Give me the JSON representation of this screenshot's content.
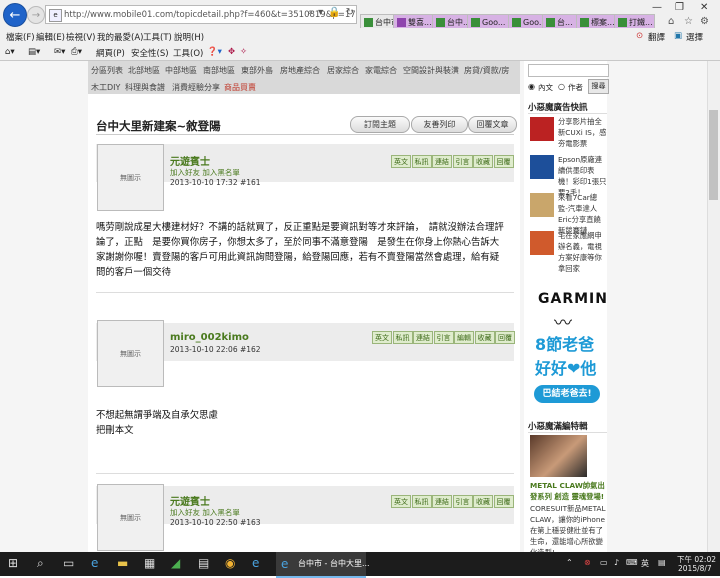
{
  "browser": {
    "url": "http://www.mobile01.com/topicdetail.php?f=460&t=3510819&p=17",
    "favicon_text": "e",
    "tabs": [
      {
        "label": "台中市",
        "color": "#e8e8e8"
      },
      {
        "label": "雙喜...",
        "color": "#d7b2e4"
      },
      {
        "label": "台中...",
        "color": "#d7b2e4"
      },
      {
        "label": "Goo...",
        "color": "#d7b2e4"
      },
      {
        "label": "Goo...",
        "color": "#d7b2e4"
      },
      {
        "label": "台...",
        "color": "#d7b2e4"
      },
      {
        "label": "標案...",
        "color": "#d7b2e4"
      },
      {
        "label": "打鐵...",
        "color": "#d7b2e4"
      }
    ],
    "menu": [
      "檔案(F)",
      "編輯(E)",
      "檢視(V)",
      "我的最愛(A)",
      "工具(T)",
      "說明(H)"
    ],
    "toolbar": [
      "網頁(P)",
      "安全性(S)",
      "工具(O)"
    ],
    "toolbar_right": [
      "翻譯",
      "選擇"
    ]
  },
  "subnav": {
    "row1": [
      "分區列表",
      "北部地區",
      "中部地區",
      "南部地區",
      "東部外島",
      "房地產綜合",
      "居家綜合",
      "家電綜合",
      "空間設計與裝潢",
      "房貸/資款/房"
    ],
    "row2": [
      "木工DIY",
      "科理與食譜",
      "消費經驗分享",
      "商品買賣"
    ]
  },
  "topic": {
    "title": "台中大里新建案~敘登陽",
    "buttons": [
      "訂閱主題",
      "友善列印",
      "回覆文章"
    ]
  },
  "posts": [
    {
      "avatar": "無圖示",
      "user": "元遊賓士",
      "links": "加入好友  加入黑名單",
      "meta": "2013-10-10 17:32  #161",
      "actions": [
        "英文",
        "私訊",
        "連結",
        "引言",
        "收藏",
        "回覆"
      ],
      "text": "嗎劳剛說成星大樓建材好？不講的話就買了，反正重點是要資訊對等才來評論，　請就沒辦法合理評論了，正點　是要你買你房子，你想太多了，至於同事不滿意登陽　是發生在你身上你熱心告訴大家謝謝你喔！賣登陽的客戶可用此資訊詢問登陽，給登陽回應，若有不賣登陽當然會處理，給有疑問的客戶一個交待"
    },
    {
      "avatar": "無圖示",
      "user": "miro_002kimo",
      "links": "",
      "meta": "2013-10-10 22:06  #162",
      "actions": [
        "英文",
        "私訊",
        "連結",
        "引言",
        "編輯",
        "收藏",
        "回覆"
      ],
      "text": "不想起無謂爭端及自承欠思慮\n把刪本文"
    },
    {
      "avatar": "無圖示",
      "user": "元遊賓士",
      "links": "加入好友  加入黑名單",
      "meta": "2013-10-10 22:50  #163",
      "actions": [
        "英文",
        "私訊",
        "連結",
        "引言",
        "收藏",
        "回覆"
      ],
      "text": ""
    }
  ],
  "sidebar": {
    "search": {
      "opt1": "內文",
      "opt2": "作者",
      "button": "搜尋"
    },
    "ads_header": "小惡魔廣告快訊",
    "ads": [
      {
        "text": "分享影片抽全新CUXi IS，感夯電影票",
        "thumb": "#b22"
      },
      {
        "text": "Epson原廠連續供墨印表機！彩印1張只要2毛！",
        "thumb": "#1d4f9a"
      },
      {
        "text": "來看7Car總監-汽車達人Eric分享直饒新競賽鏈",
        "thumb": "#c9a66b"
      },
      {
        "text": "宅在家應網申辦名義，電視方案好康等你拿回家",
        "thumb": "#d05a2c"
      }
    ],
    "garmin": {
      "brand": "GARMIN",
      "line1": "8節老爸",
      "line2": "好好❤他",
      "cta": "巴結老爸去!"
    },
    "feature_header": "小惡魔滿編特輯",
    "feature_title": "METAL CLAW帥氣出發系列 創造 靈魂登場!",
    "feature_text": "CORESUIT新品METAL CLAW，讓你的iPhone在第上穩妥健壯並有了生命，還能增心所欲變化造型!"
  },
  "taskbar": {
    "active_app": "台中市 - 台中大里...",
    "ime": "英",
    "time": "下午 02:02",
    "date": "2015/8/7"
  },
  "colors": {
    "accent_green": "#4a7a1e",
    "ie_blue": "#1f63c9",
    "garmin_blue": "#1e9ad6"
  }
}
